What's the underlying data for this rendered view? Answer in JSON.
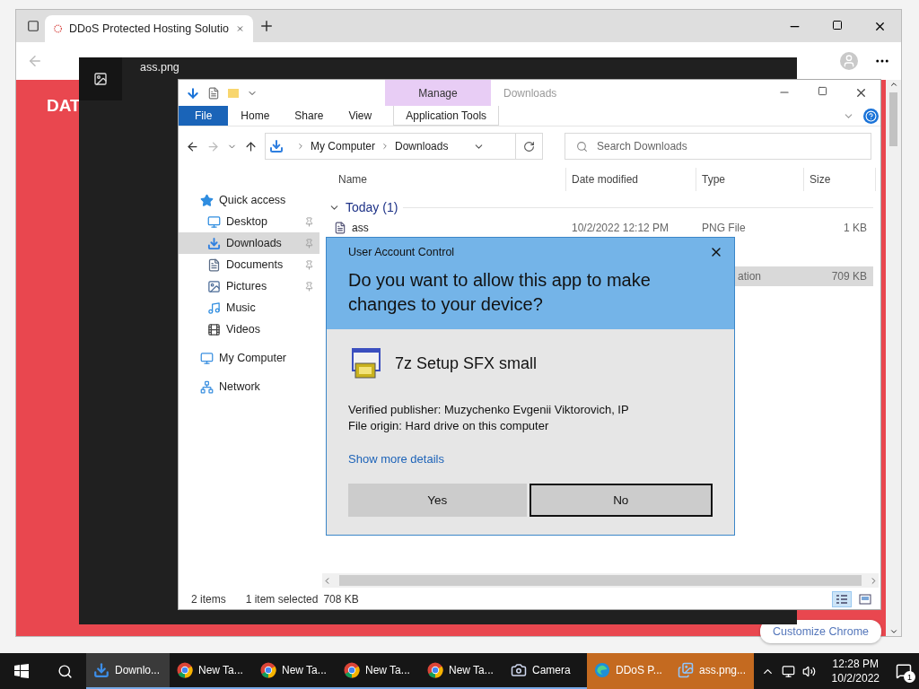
{
  "browser": {
    "tab_title": "DDoS Protected Hosting Solutio",
    "page_heading": "DAT",
    "customize_button": "Customize Chrome"
  },
  "photo_viewer": {
    "title": "ass.png"
  },
  "explorer": {
    "context_label": "Manage",
    "title": "Downloads",
    "ribbon_tabs": [
      {
        "label": "File",
        "kind": "file"
      },
      {
        "label": "Home",
        "kind": "tab"
      },
      {
        "label": "Share",
        "kind": "tab"
      },
      {
        "label": "View",
        "kind": "tab"
      },
      {
        "label": "Application Tools",
        "kind": "context"
      }
    ],
    "breadcrumb": [
      "My Computer",
      "Downloads"
    ],
    "search": {
      "placeholder": "Search Downloads"
    },
    "columns": [
      "Name",
      "Date modified",
      "Type",
      "Size"
    ],
    "sidebar": [
      {
        "label": "Quick access",
        "kind": "star",
        "selected": false,
        "children": [
          {
            "label": "Desktop",
            "kind": "desktop",
            "pinned": true,
            "selected": false
          },
          {
            "label": "Downloads",
            "kind": "downloads",
            "pinned": true,
            "selected": true
          },
          {
            "label": "Documents",
            "kind": "documents",
            "pinned": true,
            "selected": false
          },
          {
            "label": "Pictures",
            "kind": "pictures",
            "pinned": true,
            "selected": false
          },
          {
            "label": "Music",
            "kind": "music",
            "pinned": false,
            "selected": false
          },
          {
            "label": "Videos",
            "kind": "videos",
            "pinned": false,
            "selected": false
          }
        ]
      },
      {
        "label": "My Computer",
        "kind": "computer",
        "selected": false
      },
      {
        "label": "Network",
        "kind": "network",
        "selected": false
      }
    ],
    "group": "Today (1)",
    "rows": [
      {
        "name": "ass",
        "date": "10/2/2022 12:12 PM",
        "type": "PNG File",
        "size": "1 KB",
        "selected": false
      },
      {
        "type": "ation",
        "size": "709 KB",
        "selected": true,
        "clipped": true
      }
    ],
    "status": {
      "count": "2 items",
      "selection": "1 item selected",
      "size": "708 KB"
    }
  },
  "uac": {
    "title": "User Account Control",
    "question": "Do you want to allow this app to make changes to your device?",
    "app_name": "7z Setup SFX small",
    "details": [
      "Verified publisher: Muzychenko Evgenii Viktorovich, IP",
      "File origin: Hard drive on this computer"
    ],
    "link": "Show more details",
    "buttons": [
      {
        "label": "Yes",
        "focused": false
      },
      {
        "label": "No",
        "focused": true
      }
    ]
  },
  "taskbar": {
    "items": [
      {
        "label": "Downlo...",
        "kind": "explorer",
        "active": true,
        "flashing": false
      },
      {
        "label": "New Ta...",
        "kind": "chrome",
        "active": false,
        "flashing": false
      },
      {
        "label": "New Ta...",
        "kind": "chrome",
        "active": false,
        "flashing": false
      },
      {
        "label": "New Ta...",
        "kind": "chrome",
        "active": false,
        "flashing": false
      },
      {
        "label": "New Ta...",
        "kind": "chrome",
        "active": false,
        "flashing": false
      },
      {
        "label": "Camera",
        "kind": "camera",
        "active": false,
        "flashing": false
      },
      {
        "label": "DDoS P...",
        "kind": "edge",
        "active": false,
        "flashing": true
      },
      {
        "label": "ass.png...",
        "kind": "photos",
        "active": false,
        "flashing": true
      }
    ],
    "time": "12:28 PM",
    "date": "10/2/2022",
    "notifications": "1"
  }
}
